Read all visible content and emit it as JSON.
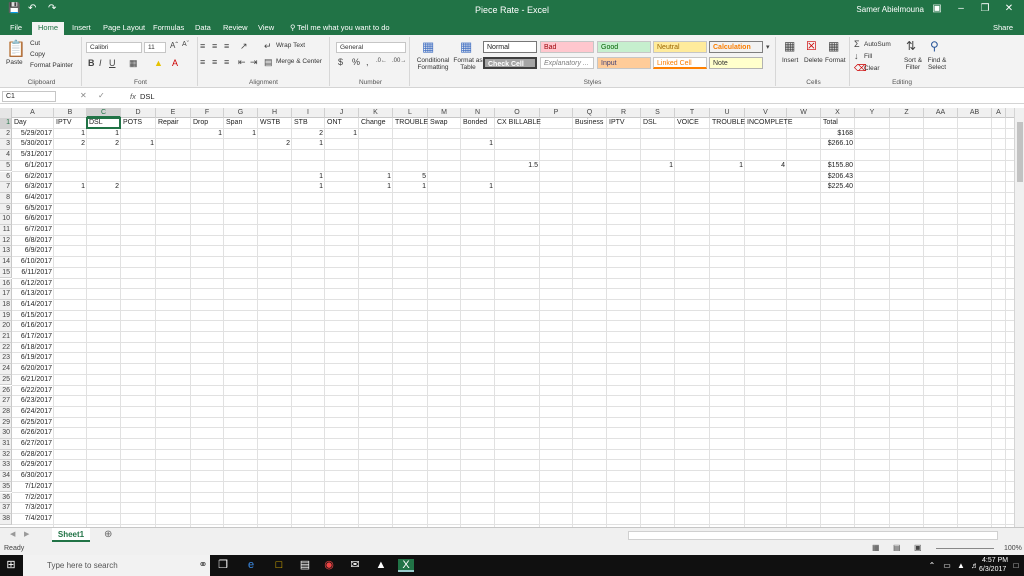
{
  "titlebar": {
    "title": "Piece Rate  -  Excel",
    "user": "Samer Abielmouna"
  },
  "tabs": [
    "File",
    "Home",
    "Insert",
    "Page Layout",
    "Formulas",
    "Data",
    "Review",
    "View"
  ],
  "tell_me": "Tell me what you want to do",
  "share": "Share",
  "ribbon": {
    "clipboard": {
      "paste": "Paste",
      "cut": "Cut",
      "copy": "Copy",
      "format_painter": "Format Painter",
      "label": "Clipboard"
    },
    "font": {
      "name": "Calibri",
      "size": "11",
      "label": "Font"
    },
    "alignment": {
      "wrap": "Wrap Text",
      "merge": "Merge & Center",
      "label": "Alignment"
    },
    "number": {
      "format": "General",
      "label": "Number"
    },
    "styles": {
      "conditional": "Conditional Formatting",
      "format_table": "Format as Table",
      "cells": [
        "Normal",
        "Bad",
        "Good",
        "Neutral",
        "Calculation",
        "Check Cell",
        "Explanatory ...",
        "Input",
        "Linked Cell",
        "Note"
      ],
      "label": "Styles"
    },
    "cells": {
      "insert": "Insert",
      "delete": "Delete",
      "format": "Format",
      "label": "Cells"
    },
    "editing": {
      "autosum": "AutoSum",
      "fill": "Fill",
      "clear": "Clear",
      "sort": "Sort & Filter",
      "find": "Find & Select",
      "label": "Editing"
    }
  },
  "formula_bar": {
    "name_box": "C1",
    "fx": "fx",
    "value": "DSL"
  },
  "columns": [
    "A",
    "B",
    "C",
    "D",
    "E",
    "F",
    "G",
    "H",
    "I",
    "J",
    "K",
    "L",
    "M",
    "N",
    "O",
    "P",
    "Q",
    "R",
    "S",
    "T",
    "U",
    "V",
    "W",
    "X",
    "Y",
    "Z",
    "AA",
    "AB",
    "A"
  ],
  "rows": [
    [
      "Day",
      "IPTV",
      "DSL",
      "POTS",
      "Repair",
      "Drop",
      "Span",
      "WSTB",
      "STB",
      "ONT",
      "Change",
      "TROUBLE",
      "Swap",
      "Bonded",
      "CX BILLABLE",
      "",
      "Business",
      "IPTV",
      "DSL",
      "VOICE",
      "TROUBLE",
      "INCOMPLETE",
      "",
      "Total"
    ],
    [
      "5/29/2017",
      "1",
      "1",
      "",
      "",
      "1",
      "1",
      "",
      "2",
      "1",
      "",
      "",
      "",
      "",
      "",
      "",
      "",
      "",
      "",
      "",
      "",
      "",
      "",
      "$168"
    ],
    [
      "5/30/2017",
      "2",
      "2",
      "1",
      "",
      "",
      "",
      "2",
      "1",
      "",
      "",
      "",
      "",
      "1",
      "",
      "",
      "",
      "",
      "",
      "",
      "",
      "",
      "",
      "$266.10"
    ],
    [
      "5/31/2017",
      "",
      "",
      "",
      "",
      "",
      "",
      "",
      "",
      "",
      "",
      "",
      "",
      "",
      "",
      "",
      "",
      "",
      "",
      "",
      "",
      "",
      "",
      ""
    ],
    [
      "6/1/2017",
      "",
      "",
      "",
      "",
      "",
      "",
      "",
      "",
      "",
      "",
      "",
      "",
      "",
      "1.5",
      "",
      "",
      "",
      "1",
      "",
      "1",
      "4",
      "",
      "$155.80"
    ],
    [
      "6/2/2017",
      "",
      "",
      "",
      "",
      "",
      "",
      "",
      "1",
      "",
      "1",
      "5",
      "",
      "",
      "",
      "",
      "",
      "",
      "",
      "",
      "",
      "",
      "",
      "$206.43"
    ],
    [
      "6/3/2017",
      "1",
      "2",
      "",
      "",
      "",
      "",
      "",
      "1",
      "",
      "1",
      "1",
      "",
      "1",
      "",
      "",
      "",
      "",
      "",
      "",
      "",
      "",
      "",
      "$225.40"
    ],
    [
      "6/4/2017"
    ],
    [
      "6/5/2017"
    ],
    [
      "6/6/2017"
    ],
    [
      "6/7/2017"
    ],
    [
      "6/8/2017"
    ],
    [
      "6/9/2017"
    ],
    [
      "6/10/2017"
    ],
    [
      "6/11/2017"
    ],
    [
      "6/12/2017"
    ],
    [
      "6/13/2017"
    ],
    [
      "6/14/2017"
    ],
    [
      "6/15/2017"
    ],
    [
      "6/16/2017"
    ],
    [
      "6/17/2017"
    ],
    [
      "6/18/2017"
    ],
    [
      "6/19/2017"
    ],
    [
      "6/20/2017"
    ],
    [
      "6/21/2017"
    ],
    [
      "6/22/2017"
    ],
    [
      "6/23/2017"
    ],
    [
      "6/24/2017"
    ],
    [
      "6/25/2017"
    ],
    [
      "6/26/2017"
    ],
    [
      "6/27/2017"
    ],
    [
      "6/28/2017"
    ],
    [
      "6/29/2017"
    ],
    [
      "6/30/2017"
    ],
    [
      "7/1/2017"
    ],
    [
      "7/2/2017"
    ],
    [
      "7/3/2017"
    ],
    [
      "7/4/2017"
    ]
  ],
  "sheet_tab": "Sheet1",
  "status": {
    "ready": "Ready",
    "zoom": "100%"
  },
  "taskbar": {
    "search": "Type here to search",
    "time": "4:57 PM",
    "date": "6/3/2017"
  }
}
